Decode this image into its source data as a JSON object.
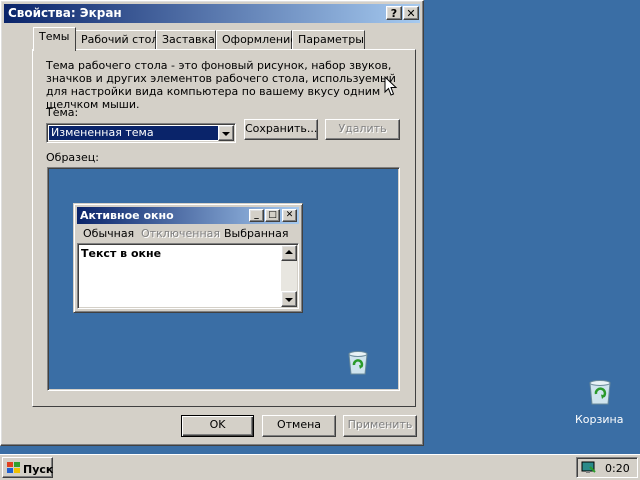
{
  "window": {
    "title": "Свойства: Экран",
    "help_btn": "?",
    "close_btn": "✕"
  },
  "tabs": [
    {
      "label": "Темы",
      "active": true
    },
    {
      "label": "Рабочий стол"
    },
    {
      "label": "Заставка"
    },
    {
      "label": "Оформление"
    },
    {
      "label": "Параметры"
    }
  ],
  "themes_tab": {
    "description": "Тема рабочего стола - это фоновый рисунок, набор звуков, значков и других элементов рабочего стола, используемый для настройки вида компьютера по вашему вкусу одним щелчком мыши.",
    "theme_label": "Тема:",
    "theme_value": "Измененная тема",
    "save_btn": "Сохранить...",
    "delete_btn": "Удалить",
    "sample_label": "Образец:"
  },
  "preview": {
    "window_title": "Активное окно",
    "menu_normal": "Обычная",
    "menu_disabled": "Отключенная",
    "menu_selected": "Выбранная",
    "window_text": "Текст в окне"
  },
  "buttons": {
    "ok": "OK",
    "cancel": "Отмена",
    "apply": "Применить"
  },
  "desktop": {
    "recycle_label": "Корзина"
  },
  "taskbar": {
    "start_label": "Пуск",
    "clock": "0:20"
  }
}
